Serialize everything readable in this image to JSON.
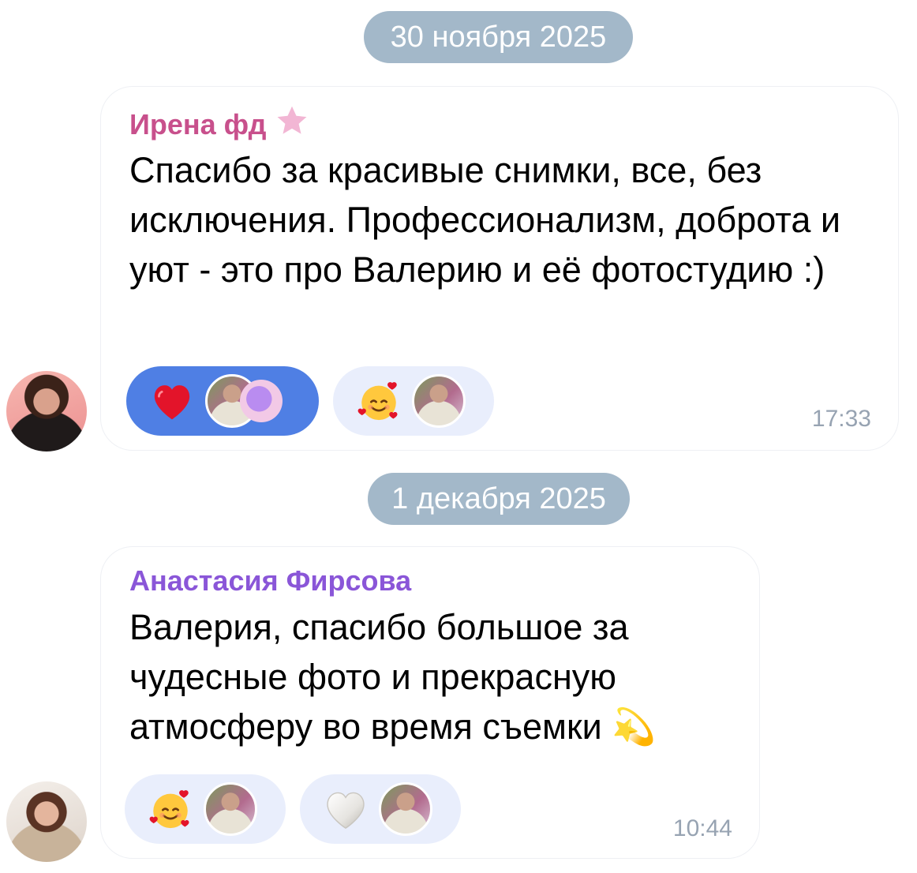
{
  "dates": [
    "30 ноября 2025",
    "1 декабря 2025"
  ],
  "messages": [
    {
      "sender": "Ирена фд",
      "text": "Спасибо за красивые снимки, все, без исключения. Профессионализм, доброта и уют - это про Валерию и её фотостудию :)",
      "time": "17:33",
      "reactions": [
        {
          "emoji": "heart-red-icon",
          "selected": true
        },
        {
          "emoji": "smiling-face-with-hearts-icon",
          "selected": false
        }
      ]
    },
    {
      "sender": "Анастасия Фирсова",
      "text": "Валерия, спасибо большое за чудесные фото и прекрасную атмосферу во время съемки 💫",
      "time": "10:44",
      "reactions": [
        {
          "emoji": "smiling-face-with-hearts-icon",
          "selected": false
        },
        {
          "emoji": "heart-white-icon",
          "selected": false
        }
      ]
    }
  ],
  "colors": {
    "date_pill": "#a3b8c9",
    "sender_1": "#c8508c",
    "sender_2": "#8a56d8",
    "reaction_selected": "#4f7fe4",
    "reaction_default": "#e9eefc",
    "time": "#97a3b2"
  }
}
